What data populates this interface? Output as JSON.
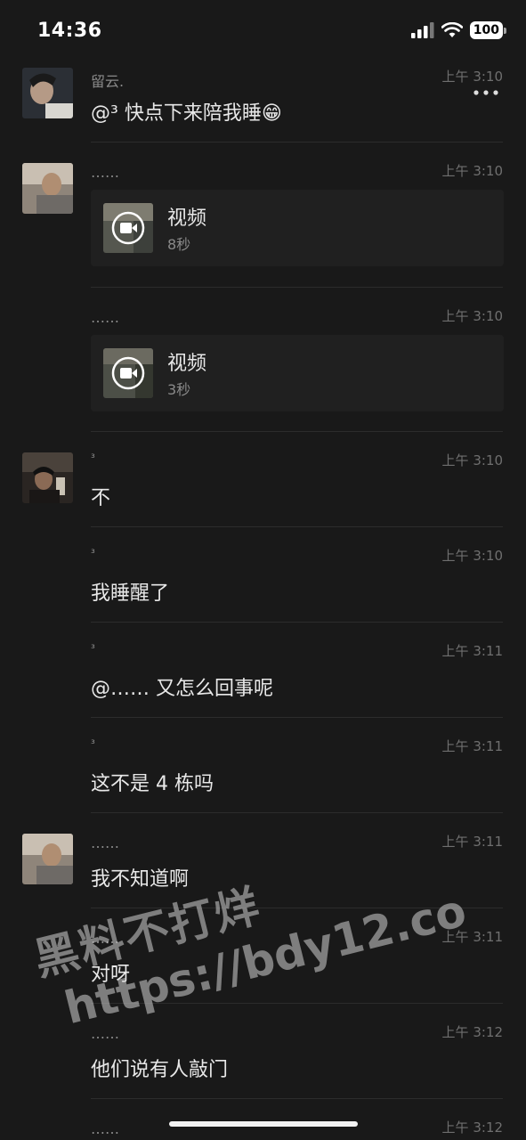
{
  "status": {
    "time": "14:36",
    "battery": "100"
  },
  "messages": [
    {
      "sender": "留云.",
      "time": "上午 3:10",
      "text": "@³ 快点下来陪我睡😁"
    },
    {
      "sender": "……",
      "time": "上午 3:10",
      "video": {
        "title": "视频",
        "duration": "8秒"
      }
    },
    {
      "sender": "……",
      "time": "上午 3:10",
      "video": {
        "title": "视频",
        "duration": "3秒"
      }
    },
    {
      "sender": "³",
      "time": "上午 3:10",
      "text": "不"
    },
    {
      "sender": "³",
      "time": "上午 3:10",
      "text": "我睡醒了"
    },
    {
      "sender": "³",
      "time": "上午 3:11",
      "text": "@…… 又怎么回事呢"
    },
    {
      "sender": "³",
      "time": "上午 3:11",
      "text": "这不是 4 栋吗"
    },
    {
      "sender": "……",
      "time": "上午 3:11",
      "text": "我不知道啊"
    },
    {
      "sender": "……",
      "time": "上午 3:11",
      "text": "对呀"
    },
    {
      "sender": "……",
      "time": "上午 3:12",
      "text": "他们说有人敲门"
    },
    {
      "sender": "……",
      "time": "上午 3:12"
    }
  ],
  "watermark": {
    "line1": "黑料不打烊",
    "line2": "https://bdy12.co"
  },
  "icons": [
    "signal-icon",
    "wifi-icon",
    "battery-icon",
    "more-icon",
    "video-play-icon"
  ]
}
